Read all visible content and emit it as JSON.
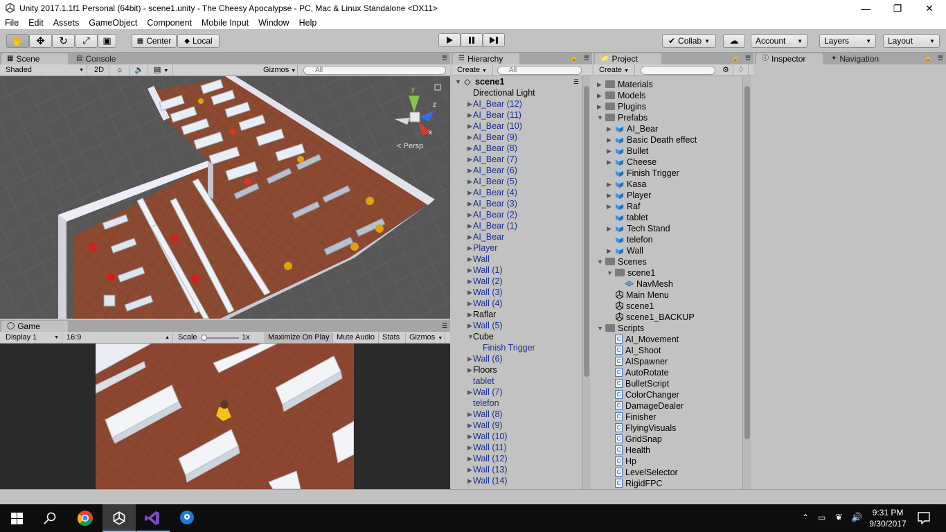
{
  "window": {
    "title": "Unity 2017.1.1f1 Personal (64bit) - scene1.unity - The Cheesy Apocalypse - PC, Mac & Linux Standalone <DX11>"
  },
  "menu": [
    "File",
    "Edit",
    "Assets",
    "GameObject",
    "Component",
    "Mobile Input",
    "Window",
    "Help"
  ],
  "toolbar": {
    "center": "Center",
    "local": "Local",
    "collab": "Collab",
    "account": "Account",
    "layers": "Layers",
    "layout": "Layout"
  },
  "scene_panel": {
    "tab_scene": "Scene",
    "tab_console": "Console",
    "shaded": "Shaded",
    "two_d": "2D",
    "gizmos": "Gizmos",
    "search": "All",
    "persp": "Persp",
    "axis_y": "y",
    "axis_z": "z",
    "axis_x": "x"
  },
  "game_panel": {
    "tab": "Game",
    "display": "Display 1",
    "aspect": "16:9",
    "scale_label": "Scale",
    "scale_value": "1x",
    "maximize": "Maximize On Play",
    "mute": "Mute Audio",
    "stats": "Stats",
    "gizmos": "Gizmos"
  },
  "hierarchy": {
    "tab": "Hierarchy",
    "create": "Create",
    "search": "All",
    "scene": "scene1",
    "items": [
      {
        "label": "Directional Light",
        "arrow": false,
        "indent": 0,
        "color": "black"
      },
      {
        "label": "AI_Bear (12)",
        "arrow": true,
        "indent": 0,
        "color": "blue"
      },
      {
        "label": "AI_Bear (11)",
        "arrow": true,
        "indent": 0,
        "color": "blue"
      },
      {
        "label": "AI_Bear (10)",
        "arrow": true,
        "indent": 0,
        "color": "blue"
      },
      {
        "label": "AI_Bear (9)",
        "arrow": true,
        "indent": 0,
        "color": "blue"
      },
      {
        "label": "AI_Bear (8)",
        "arrow": true,
        "indent": 0,
        "color": "blue"
      },
      {
        "label": "AI_Bear (7)",
        "arrow": true,
        "indent": 0,
        "color": "blue"
      },
      {
        "label": "AI_Bear (6)",
        "arrow": true,
        "indent": 0,
        "color": "blue"
      },
      {
        "label": "AI_Bear (5)",
        "arrow": true,
        "indent": 0,
        "color": "blue"
      },
      {
        "label": "AI_Bear (4)",
        "arrow": true,
        "indent": 0,
        "color": "blue"
      },
      {
        "label": "AI_Bear (3)",
        "arrow": true,
        "indent": 0,
        "color": "blue"
      },
      {
        "label": "AI_Bear (2)",
        "arrow": true,
        "indent": 0,
        "color": "blue"
      },
      {
        "label": "AI_Bear (1)",
        "arrow": true,
        "indent": 0,
        "color": "blue"
      },
      {
        "label": "AI_Bear",
        "arrow": true,
        "indent": 0,
        "color": "blue"
      },
      {
        "label": "Player",
        "arrow": true,
        "indent": 0,
        "color": "blue"
      },
      {
        "label": "Wall",
        "arrow": true,
        "indent": 0,
        "color": "blue"
      },
      {
        "label": "Wall (1)",
        "arrow": true,
        "indent": 0,
        "color": "blue"
      },
      {
        "label": "Wall (2)",
        "arrow": true,
        "indent": 0,
        "color": "blue"
      },
      {
        "label": "Wall (3)",
        "arrow": true,
        "indent": 0,
        "color": "blue"
      },
      {
        "label": "Wall (4)",
        "arrow": true,
        "indent": 0,
        "color": "blue"
      },
      {
        "label": "Raflar",
        "arrow": true,
        "indent": 0,
        "color": "black"
      },
      {
        "label": "Wall (5)",
        "arrow": true,
        "indent": 0,
        "color": "blue"
      },
      {
        "label": "Cube",
        "arrow": "open",
        "indent": 0,
        "color": "black"
      },
      {
        "label": "Finish Trigger",
        "arrow": false,
        "indent": 1,
        "color": "blue"
      },
      {
        "label": "Wall (6)",
        "arrow": true,
        "indent": 0,
        "color": "blue"
      },
      {
        "label": "Floors",
        "arrow": true,
        "indent": 0,
        "color": "black"
      },
      {
        "label": "tablet",
        "arrow": false,
        "indent": 0,
        "color": "blue"
      },
      {
        "label": "Wall (7)",
        "arrow": true,
        "indent": 0,
        "color": "blue"
      },
      {
        "label": "telefon",
        "arrow": false,
        "indent": 0,
        "color": "blue"
      },
      {
        "label": "Wall (8)",
        "arrow": true,
        "indent": 0,
        "color": "blue"
      },
      {
        "label": "Wall (9)",
        "arrow": true,
        "indent": 0,
        "color": "blue"
      },
      {
        "label": "Wall (10)",
        "arrow": true,
        "indent": 0,
        "color": "blue"
      },
      {
        "label": "Wall (11)",
        "arrow": true,
        "indent": 0,
        "color": "blue"
      },
      {
        "label": "Wall (12)",
        "arrow": true,
        "indent": 0,
        "color": "blue"
      },
      {
        "label": "Wall (13)",
        "arrow": true,
        "indent": 0,
        "color": "blue"
      },
      {
        "label": "Wall (14)",
        "arrow": true,
        "indent": 0,
        "color": "blue"
      }
    ]
  },
  "project": {
    "tab": "Project",
    "create": "Create",
    "items": [
      {
        "label": "Materials",
        "arrow": "closed",
        "indent": 0,
        "icon": "folder"
      },
      {
        "label": "Models",
        "arrow": "closed",
        "indent": 0,
        "icon": "folder"
      },
      {
        "label": "Plugins",
        "arrow": "closed",
        "indent": 0,
        "icon": "folder"
      },
      {
        "label": "Prefabs",
        "arrow": "open",
        "indent": 0,
        "icon": "folder"
      },
      {
        "label": "AI_Bear",
        "arrow": "closed",
        "indent": 1,
        "icon": "cube"
      },
      {
        "label": "Basic Death effect",
        "arrow": "closed",
        "indent": 1,
        "icon": "cube"
      },
      {
        "label": "Bullet",
        "arrow": "closed",
        "indent": 1,
        "icon": "cube"
      },
      {
        "label": "Cheese",
        "arrow": "closed",
        "indent": 1,
        "icon": "cube"
      },
      {
        "label": "Finish Trigger",
        "arrow": "none",
        "indent": 1,
        "icon": "cube"
      },
      {
        "label": "Kasa",
        "arrow": "closed",
        "indent": 1,
        "icon": "cube"
      },
      {
        "label": "Player",
        "arrow": "closed",
        "indent": 1,
        "icon": "cube"
      },
      {
        "label": "Raf",
        "arrow": "closed",
        "indent": 1,
        "icon": "cube"
      },
      {
        "label": "tablet",
        "arrow": "none",
        "indent": 1,
        "icon": "cube"
      },
      {
        "label": "Tech Stand",
        "arrow": "closed",
        "indent": 1,
        "icon": "cube"
      },
      {
        "label": "telefon",
        "arrow": "none",
        "indent": 1,
        "icon": "cube"
      },
      {
        "label": "Wall",
        "arrow": "closed",
        "indent": 1,
        "icon": "cube"
      },
      {
        "label": "Scenes",
        "arrow": "open",
        "indent": 0,
        "icon": "folder"
      },
      {
        "label": "scene1",
        "arrow": "open",
        "indent": 1,
        "icon": "folder"
      },
      {
        "label": "NavMesh",
        "arrow": "none",
        "indent": 2,
        "icon": "navmesh"
      },
      {
        "label": "Main Menu",
        "arrow": "none",
        "indent": 1,
        "icon": "unity"
      },
      {
        "label": "scene1",
        "arrow": "none",
        "indent": 1,
        "icon": "unity"
      },
      {
        "label": "scene1_BACKUP",
        "arrow": "none",
        "indent": 1,
        "icon": "unity"
      },
      {
        "label": "Scripts",
        "arrow": "open",
        "indent": 0,
        "icon": "folder"
      },
      {
        "label": "AI_Movement",
        "arrow": "none",
        "indent": 1,
        "icon": "script"
      },
      {
        "label": "AI_Shoot",
        "arrow": "none",
        "indent": 1,
        "icon": "script"
      },
      {
        "label": "AISpawner",
        "arrow": "none",
        "indent": 1,
        "icon": "script"
      },
      {
        "label": "AutoRotate",
        "arrow": "none",
        "indent": 1,
        "icon": "script"
      },
      {
        "label": "BulletScript",
        "arrow": "none",
        "indent": 1,
        "icon": "script"
      },
      {
        "label": "ColorChanger",
        "arrow": "none",
        "indent": 1,
        "icon": "script"
      },
      {
        "label": "DamageDealer",
        "arrow": "none",
        "indent": 1,
        "icon": "script"
      },
      {
        "label": "Finisher",
        "arrow": "none",
        "indent": 1,
        "icon": "script"
      },
      {
        "label": "FlyingVisuals",
        "arrow": "none",
        "indent": 1,
        "icon": "script"
      },
      {
        "label": "GridSnap",
        "arrow": "none",
        "indent": 1,
        "icon": "script"
      },
      {
        "label": "Health",
        "arrow": "none",
        "indent": 1,
        "icon": "script"
      },
      {
        "label": "Hp",
        "arrow": "none",
        "indent": 1,
        "icon": "script"
      },
      {
        "label": "LevelSelector",
        "arrow": "none",
        "indent": 1,
        "icon": "script"
      },
      {
        "label": "RigidFPC",
        "arrow": "none",
        "indent": 1,
        "icon": "script"
      }
    ]
  },
  "inspector": {
    "tab_inspector": "Inspector",
    "tab_navigation": "Navigation"
  },
  "taskbar": {
    "time": "9:31 PM",
    "date": "9/30/2017"
  },
  "colors": {
    "floor": "#8a4a32",
    "wall": "#d9d9e6",
    "scene_bg": "#5a5a5a"
  }
}
